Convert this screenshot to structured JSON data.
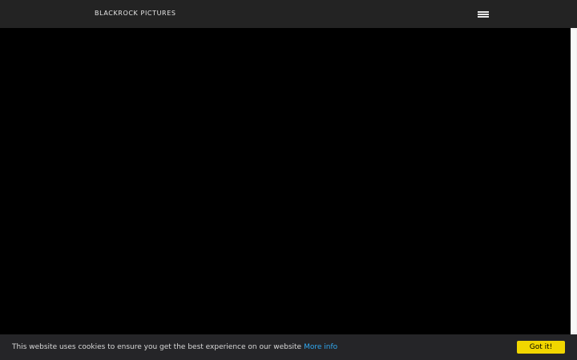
{
  "navbar": {
    "brand": "BLACKROCK PICTURES",
    "menu_icon": "hamburger-menu-icon",
    "background": "#232323"
  },
  "hero": {
    "background": "#000000"
  },
  "cookie_bar": {
    "message": "This website uses cookies to ensure you get the best experience on our website",
    "link_label": "More info",
    "button_label": "Got it!",
    "link_color": "#31a8f0",
    "button_color": "#f1d600"
  }
}
